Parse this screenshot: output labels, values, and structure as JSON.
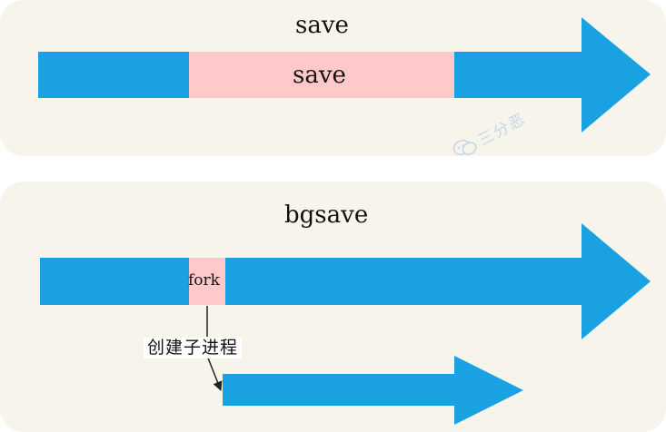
{
  "top_panel": {
    "title": "save",
    "block_label": "save"
  },
  "bottom_panel": {
    "title": "bgsave",
    "fork_label": "fork",
    "child_label": "创建子进程"
  },
  "watermark": {
    "icon": "wechat-icon",
    "text": "三分恶"
  },
  "colors": {
    "panel_bg": "#f7f4ec",
    "arrow_blue": "#1aa1e1",
    "block_pink": "#ffc9c9",
    "pointer_line": "#222222"
  }
}
